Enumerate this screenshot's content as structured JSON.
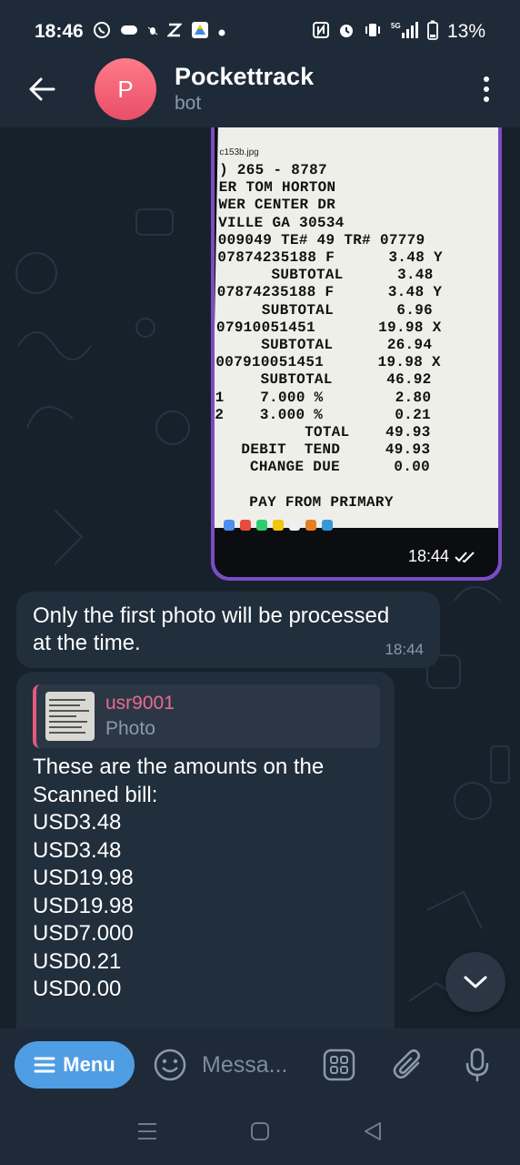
{
  "status_bar": {
    "time": "18:46",
    "network": "5G",
    "battery": "13%"
  },
  "header": {
    "avatar_letter": "P",
    "title": "Pockettrack",
    "subtitle": "bot"
  },
  "photo_message": {
    "file_name": "c153b.jpg",
    "time": "18:44",
    "receipt_lines": [
      ") 265 - 8787",
      "ER TOM HORTON",
      "WER CENTER DR",
      "VILLE GA 30534",
      "009049 TE# 49 TR# 07779",
      "07874235188 F      3.48 Y",
      "      SUBTOTAL      3.48",
      "07874235188 F      3.48 Y",
      "     SUBTOTAL       6.96",
      "07910051451       19.98 X",
      "     SUBTOTAL      26.94",
      "007910051451      19.98 X",
      "     SUBTOTAL      46.92",
      "1    7.000 %        2.80",
      "2    3.000 %        0.21",
      "          TOTAL    49.93",
      "   DEBIT  TEND     49.93",
      "    CHANGE DUE      0.00",
      "",
      "    PAY FROM PRIMARY"
    ]
  },
  "notice_message": {
    "text": "Only the first photo will be processed\nat the time.",
    "time": "18:44"
  },
  "reply_message": {
    "quote_name": "usr9001",
    "quote_type": "Photo",
    "intro_lines": [
      "These are the amounts on the",
      "Scanned bill:"
    ],
    "amounts": [
      "USD3.48",
      "USD3.48",
      "USD19.98",
      "USD19.98",
      "USD7.000",
      "USD0.21",
      "USD0.00"
    ]
  },
  "input_bar": {
    "menu_label": "Menu",
    "placeholder": "Messa..."
  },
  "colors": {
    "header_bg": "#1e2a37",
    "chat_bg": "#17212b",
    "bubble_bg": "#212e3b",
    "accent_blue": "#4f9de3",
    "avatar_pink": "#e94e68",
    "quote_pink": "#e96b8e",
    "photo_border": "#7b4cc4"
  },
  "icons": {
    "back": "arrow-left-icon",
    "more": "more-vertical-icon",
    "scroll": "chevron-down-icon",
    "emoji": "smile-icon",
    "commands": "grid-icon",
    "attach": "paperclip-icon",
    "mic": "microphone-icon"
  }
}
